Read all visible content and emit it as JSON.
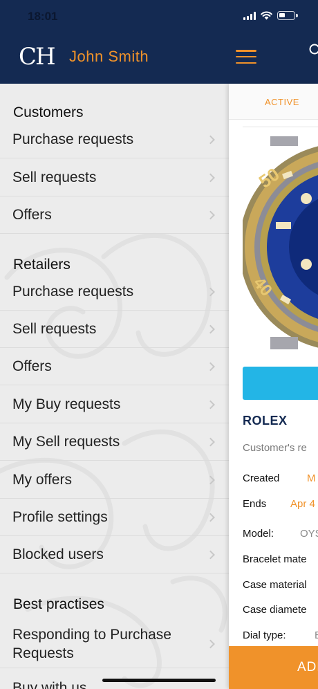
{
  "status": {
    "time": "18:01"
  },
  "header": {
    "logo": "CH",
    "user_name": "John Smith",
    "icons": [
      "menu-icon",
      "search-icon",
      "signal-icon",
      "wifi-icon",
      "battery-icon"
    ]
  },
  "sidebar": {
    "sections": [
      {
        "title": "Customers",
        "items": [
          "Purchase requests",
          "Sell requests",
          "Offers"
        ]
      },
      {
        "title": "Retailers",
        "items": [
          "Purchase requests",
          "Sell requests",
          "Offers",
          "My Buy requests",
          "My Sell requests",
          "My offers",
          "Profile settings",
          "Blocked users"
        ]
      },
      {
        "title": "Best practises",
        "items": [
          "Responding to Purchase Requests",
          "Buy with us"
        ]
      }
    ]
  },
  "main": {
    "tab_active": "ACTIVE",
    "brand": "ROLEX",
    "description": "Customer's re",
    "rows": [
      {
        "label": "Created",
        "value": "M"
      },
      {
        "label": "Ends",
        "value": "Apr 4"
      },
      {
        "label": "Model:",
        "value": "OYS"
      },
      {
        "label": "Bracelet mate",
        "value": ""
      },
      {
        "label": "Case material",
        "value": ""
      },
      {
        "label": "Case diamete",
        "value": ""
      },
      {
        "label": "Dial type:",
        "value": "E"
      }
    ],
    "bottom_button": "ADD"
  },
  "colors": {
    "navy": "#142a52",
    "orange": "#f0922a",
    "blue": "#23b5e6",
    "sidebar_bg": "#ececec"
  }
}
